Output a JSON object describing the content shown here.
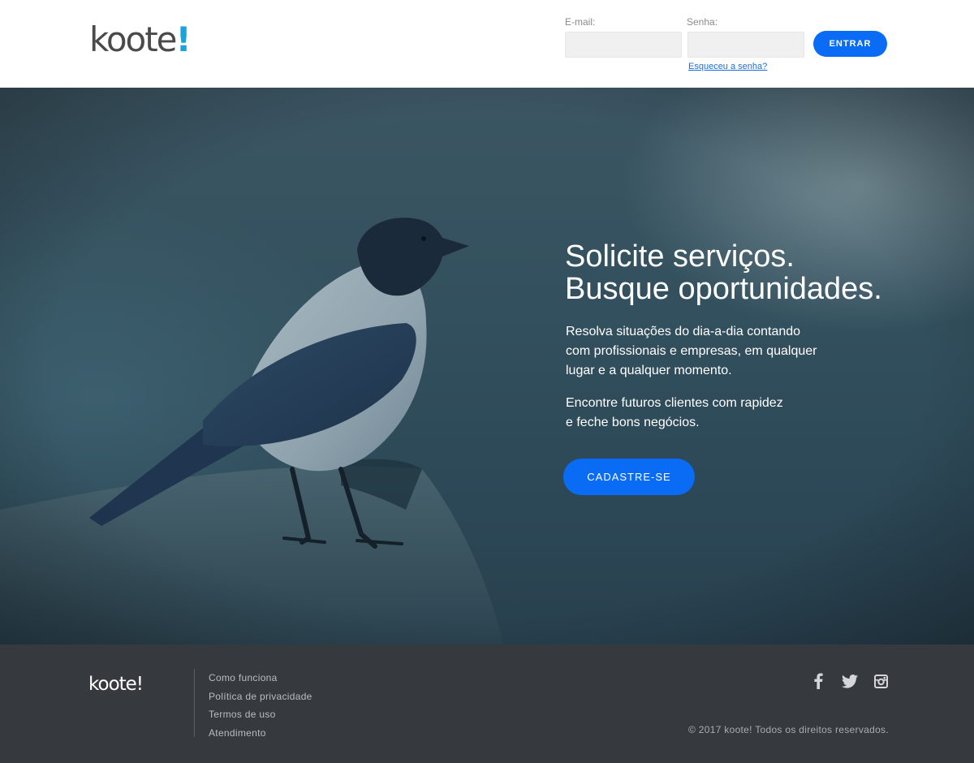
{
  "header": {
    "logo_text": "koote",
    "logo_accent": "!",
    "email_label": "E-mail:",
    "email_value": "",
    "password_label": "Senha:",
    "password_value": "",
    "login_button": "ENTRAR",
    "forgot_link": "Esqueceu a senha?"
  },
  "hero": {
    "title_line1": "Solicite serviços.",
    "title_line2": "Busque oportunidades.",
    "para1_line1": "Resolva situações do dia-a-dia contando",
    "para1_line2": "com profissionais e empresas, em qualquer",
    "para1_line3": "lugar e a qualquer momento.",
    "para2_line1": "Encontre futuros clientes com rapidez",
    "para2_line2": "e feche bons negócios.",
    "signup_button": "CADASTRE-SE"
  },
  "footer": {
    "logo_text": "koote!",
    "links": [
      "Como funciona",
      "Política de privacidade",
      "Termos de uso",
      "Atendimento"
    ],
    "social": [
      "facebook-icon",
      "twitter-icon",
      "instagram-icon"
    ],
    "copyright": "© 2017 koote! Todos os direitos reservados."
  },
  "colors": {
    "accent": "#0a6cf5",
    "logo_accent": "#1aa4dc",
    "footer_bg": "#36393d",
    "hero_bg": "#33505e"
  }
}
